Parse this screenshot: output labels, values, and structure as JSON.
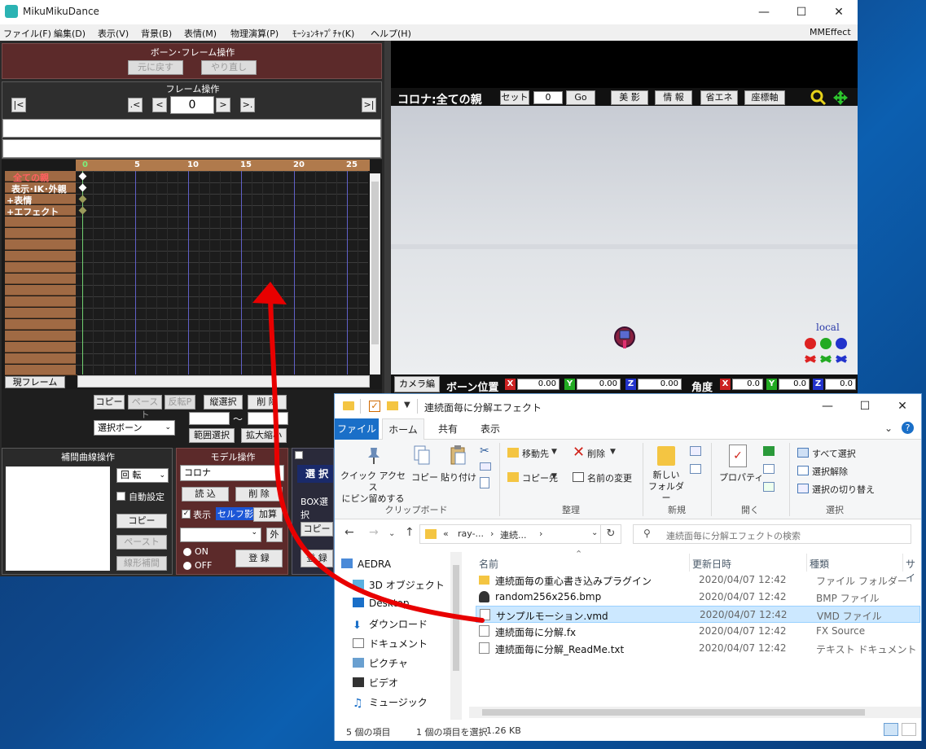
{
  "mmd": {
    "title": "MikuMikuDance",
    "menu": [
      "ファイル(F)",
      "編集(D)",
      "表示(V)",
      "背景(B)",
      "表情(M)",
      "物理演算(P)",
      "ﾓｰｼｮﾝｷｬﾌﾟﾁｬ(K)",
      "ヘルプ(H)"
    ],
    "mmeffect": "MMEffect",
    "bone_frame": {
      "title": "ボーン･フレーム操作",
      "undo": "元に戻す",
      "redo": "やり直し"
    },
    "frame_ops": {
      "title": "フレーム操作",
      "frame_value": "0",
      "first": "|<",
      "prev_key": ".<",
      "prev": "<",
      "next": ">",
      "next_key": ">.",
      "last": ">|"
    },
    "timeline": {
      "ticks": [
        "0",
        "5",
        "10",
        "15",
        "20",
        "25"
      ],
      "bones": [
        "全ての親",
        "表示･IK･外親",
        "+表情",
        "+エフェクト"
      ],
      "current_frame_btn": "現フレーム"
    },
    "edit_ops": {
      "copy": "コピー",
      "paste": "ペースト",
      "rev_paste": "反転P",
      "vsel": "縦選択",
      "delete": "削 除",
      "select_bone": "選択ボーン",
      "tilde": "～",
      "range_sel": "範囲選択",
      "scale": "拡大縮小"
    },
    "interp": {
      "title": "補間曲線操作",
      "rotate": "回 転",
      "auto": "自動設定",
      "copy": "コピー",
      "paste": "ペースト",
      "linear": "線形補間"
    },
    "model_ops": {
      "title": "モデル操作",
      "model": "コロナ",
      "load": "読 込",
      "delete": "削 除",
      "show": "表示",
      "self_shadow": "セルフ影",
      "add": "加算",
      "outer": "外",
      "on": "ON",
      "off": "OFF",
      "register": "登 録"
    },
    "third_panel": {
      "select": "選 択",
      "box": "BOX選択",
      "copy": "コピー",
      "register": "登 録"
    },
    "viewport": {
      "model_label": "コロナ:全ての親",
      "set": "セット",
      "frame": "0",
      "go": "Go",
      "buttons": [
        "美 影",
        "情 報",
        "省エネ",
        "座標軸"
      ],
      "local": "local",
      "camera_tab": "カメラ編",
      "bone_pos": "ボーン位置",
      "pos": {
        "x": "0.00",
        "y": "0.00",
        "z": "0.00"
      },
      "angle_label": "角度",
      "angle": {
        "x": "0.0",
        "y": "0.0",
        "z": "0.0"
      }
    }
  },
  "explorer": {
    "title": "連続面毎に分解エフェクト",
    "tabs": [
      "ファイル",
      "ホーム",
      "共有",
      "表示"
    ],
    "ribbon": {
      "pin": "クイック アクセス\nにピン留めする",
      "copy": "コピー",
      "paste": "貼り付け",
      "move_to": "移動先",
      "copy_to": "コピー先",
      "delete": "削除",
      "rename": "名前の変更",
      "new_folder": "新しい\nフォルダー",
      "properties": "プロパティ",
      "select_all": "すべて選択",
      "select_none": "選択解除",
      "invert": "選択の切り替え",
      "groups": [
        "クリップボード",
        "整理",
        "新規",
        "開く",
        "選択"
      ]
    },
    "address": {
      "parts": [
        "«",
        "ray-...",
        "›",
        "連続...",
        "›"
      ],
      "search": "連続面毎に分解エフェクトの検索"
    },
    "nav": [
      "AEDRA",
      "3D オブジェクト",
      "Desktop",
      "ダウンロード",
      "ドキュメント",
      "ピクチャ",
      "ビデオ",
      "ミュージック"
    ],
    "columns": [
      "名前",
      "更新日時",
      "種類",
      "サイ"
    ],
    "files": [
      {
        "name": "連続面毎の重心書き込みプラグイン",
        "date": "2020/04/07 12:42",
        "type": "ファイル フォルダー",
        "icon": "folder-icon"
      },
      {
        "name": "random256x256.bmp",
        "date": "2020/04/07 12:42",
        "type": "BMP ファイル",
        "icon": "bmp-icon"
      },
      {
        "name": "サンプルモーション.vmd",
        "date": "2020/04/07 12:42",
        "type": "VMD ファイル",
        "icon": "file-icon",
        "selected": true
      },
      {
        "name": "連続面毎に分解.fx",
        "date": "2020/04/07 12:42",
        "type": "FX Source",
        "icon": "file-icon"
      },
      {
        "name": "連続面毎に分解_ReadMe.txt",
        "date": "2020/04/07 12:42",
        "type": "テキスト ドキュメント",
        "icon": "text-icon"
      }
    ],
    "status": {
      "count": "5 個の項目",
      "selected": "1 個の項目を選択",
      "size": "1.26 KB"
    }
  }
}
